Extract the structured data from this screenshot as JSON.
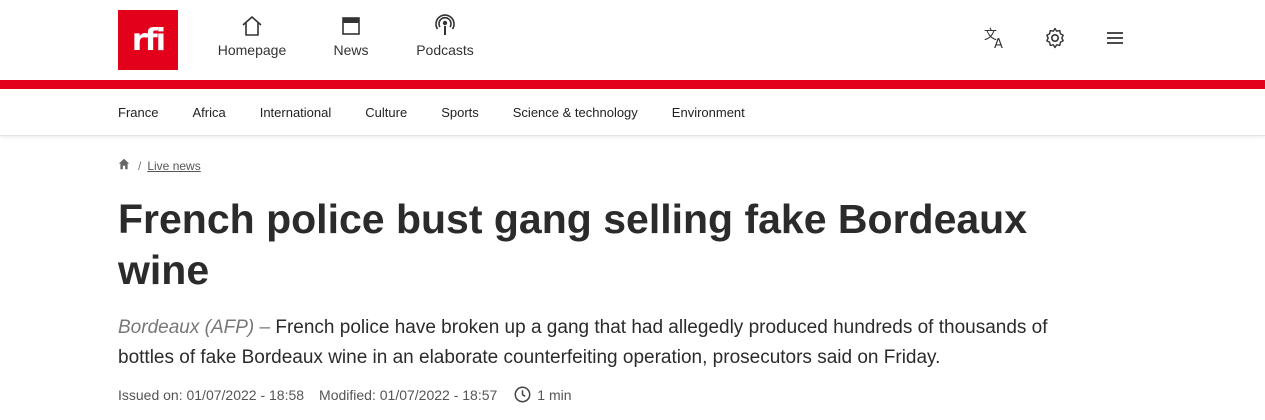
{
  "brand": {
    "logo_text": "rfi",
    "color": "#e2001a"
  },
  "top_nav": [
    {
      "label": "Homepage",
      "icon": "home-icon"
    },
    {
      "label": "News",
      "icon": "news-icon"
    },
    {
      "label": "Podcasts",
      "icon": "podcast-icon"
    }
  ],
  "header_actions": [
    {
      "icon": "language-icon"
    },
    {
      "icon": "gear-icon"
    },
    {
      "icon": "hamburger-menu-icon"
    }
  ],
  "section_nav": [
    "France",
    "Africa",
    "International",
    "Culture",
    "Sports",
    "Science & technology",
    "Environment"
  ],
  "breadcrumb": {
    "home_icon": "home-icon",
    "separator": "/",
    "current": "Live news"
  },
  "article": {
    "headline": "French police bust gang selling fake Bordeaux wine",
    "dateline": "Bordeaux (AFP) –",
    "lede": "French police have broken up a gang that had allegedly produced hundreds of thousands of bottles of fake Bordeaux wine in an elaborate counterfeiting operation, prosecutors said on Friday.",
    "issued": "Issued on: 01/07/2022 - 18:58",
    "modified": "Modified: 01/07/2022 - 18:57",
    "read_time": "1 min",
    "read_time_icon": "clock-icon"
  }
}
